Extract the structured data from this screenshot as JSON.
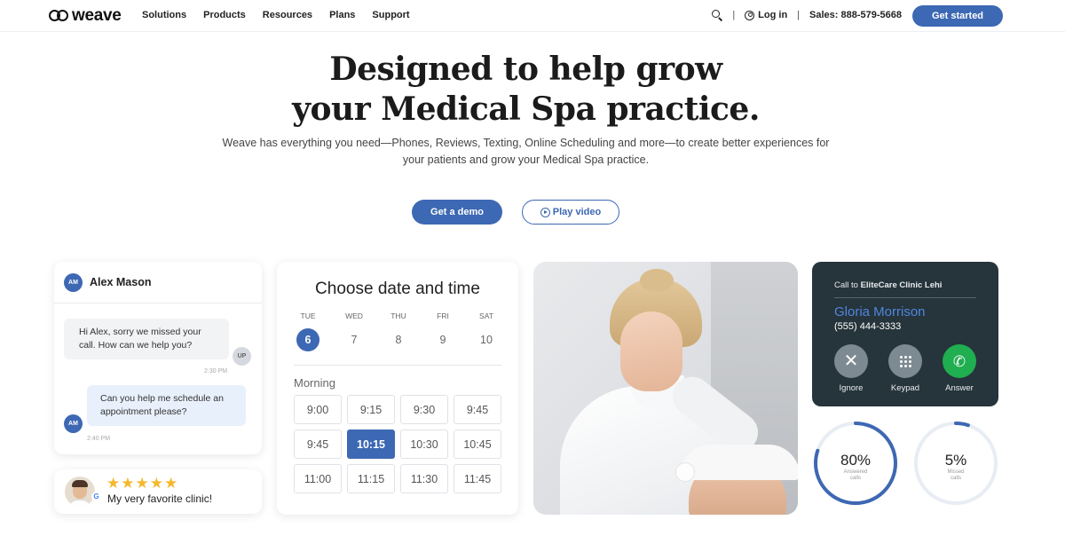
{
  "nav": {
    "logo": "weave",
    "links": [
      "Solutions",
      "Products",
      "Resources",
      "Plans",
      "Support"
    ],
    "login": "Log in",
    "sales": "Sales: 888-579-5668",
    "cta": "Get started"
  },
  "hero": {
    "title_line1": "Designed to help grow",
    "title_line2": "your Medical Spa practice.",
    "subtitle": "Weave has everything you need—Phones, Reviews, Texting, Online Scheduling and more—to create better experiences for your patients and grow your Medical Spa practice.",
    "demo_button": "Get a demo",
    "video_button": "Play video"
  },
  "chat": {
    "name": "Alex Mason",
    "initials": "AM",
    "message1": "Hi Alex, sorry we missed your call. How can we help you?",
    "reply_initials": "UP",
    "time1": "2:30 PM",
    "message2": "Can you help me schedule an appointment please?",
    "time2": "2:40 PM"
  },
  "review": {
    "rating": 5,
    "stars": "★★★★★",
    "text": "My very favorite clinic!",
    "source_badge": "G"
  },
  "calendar": {
    "title": "Choose date and time",
    "days": [
      {
        "name": "TUE",
        "num": "6",
        "selected": true
      },
      {
        "name": "WED",
        "num": "7",
        "selected": false
      },
      {
        "name": "THU",
        "num": "8",
        "selected": false
      },
      {
        "name": "FRI",
        "num": "9",
        "selected": false
      },
      {
        "name": "SAT",
        "num": "10",
        "selected": false
      }
    ],
    "section": "Morning",
    "slots": [
      "9:00",
      "9:15",
      "9:30",
      "9:45",
      "9:45",
      "10:15",
      "10:30",
      "10:45",
      "11:00",
      "11:15",
      "11:30",
      "11:45"
    ],
    "selected_slot": "10:15"
  },
  "call": {
    "to_prefix": "Call to ",
    "clinic": "EliteCare Clinic Lehi",
    "caller": "Gloria Morrison",
    "phone": "(555) 444-3333",
    "ignore": "Ignore",
    "keypad": "Keypad",
    "answer": "Answer"
  },
  "stats": [
    {
      "value": "80%",
      "fraction": 0.8,
      "label_line1": "Answered",
      "label_line2": "calls"
    },
    {
      "value": "5%",
      "fraction": 0.05,
      "label_line1": "Missed",
      "label_line2": "calls"
    }
  ],
  "colors": {
    "primary": "#3d68b3",
    "call_bg": "#26343b",
    "answer_green": "#1fae50",
    "star": "#f5b82e",
    "caller_name": "#4f86e0"
  },
  "icons": {
    "search": "search-icon",
    "user": "user-icon",
    "play": "play-circle-icon",
    "ignore": "close-icon",
    "keypad": "keypad-icon",
    "answer": "phone-icon"
  }
}
